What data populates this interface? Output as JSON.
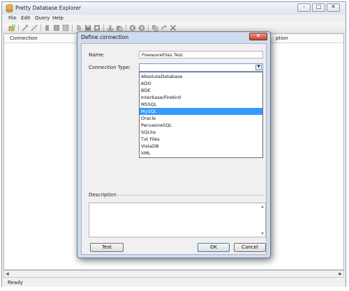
{
  "window": {
    "title": "Pretty Database Explorer",
    "buttons": {
      "minimize": "–",
      "maximize": "□",
      "close": "✕"
    }
  },
  "menu": [
    "File",
    "Edit",
    "Query",
    "Help"
  ],
  "toolbar": {
    "icons": [
      "add-connection-icon",
      "connect-icon",
      "disconnect-icon",
      "properties-icon",
      "database-icon",
      "grid-icon",
      "new-query-icon",
      "save-icon",
      "stop-icon",
      "cut-icon",
      "paste-icon",
      "back-icon",
      "forward-icon",
      "copy-icon",
      "redo-icon",
      "delete-icon"
    ]
  },
  "main": {
    "column_header": "Connection",
    "column_header_right": "ption"
  },
  "status": {
    "text": "Ready"
  },
  "dialog": {
    "title": "Define connection",
    "close_glyph": "✕",
    "name_label": "Name:",
    "name_value": "FreewareFiles Test",
    "type_label": "Connection Type:",
    "type_value": "",
    "type_options": [
      "AbsoluteDatabase",
      "ADO",
      "BDE",
      "Interbase/Firebird",
      "MSSQL",
      "MySQL",
      "Oracle",
      "PervasiveSQL",
      "SQLite",
      "Txt Files",
      "VistaDB",
      "XML"
    ],
    "highlighted_option": "MySQL",
    "description_label": "Description",
    "description_value": "",
    "test_label": "Test",
    "ok_label": "OK",
    "cancel_label": "Cancel"
  },
  "colors": {
    "selection": "#3399ff",
    "dialog_frame": "#cfdced",
    "close_button": "#c5432e"
  }
}
